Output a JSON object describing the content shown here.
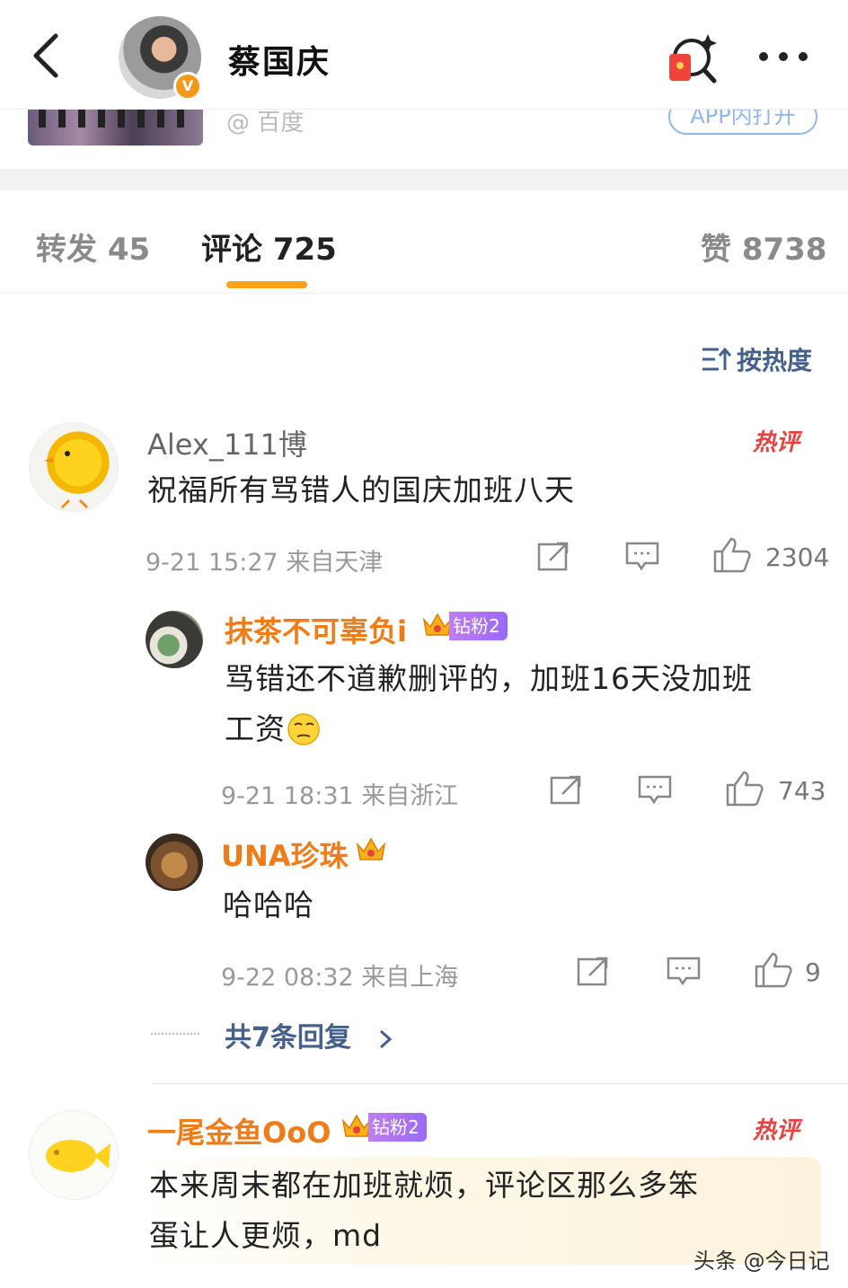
{
  "header": {
    "title": "蔡国庆",
    "verified_badge": "V"
  },
  "card": {
    "source": "@ 百度",
    "open_app_label": "APP内打开"
  },
  "tabs": [
    {
      "label": "转发 45"
    },
    {
      "label": "评论 725"
    },
    {
      "label": "赞 8738"
    }
  ],
  "sort": {
    "label": "按热度"
  },
  "hot_label": "热评",
  "comments": [
    {
      "user": "Alex_111博",
      "text": "祝福所有骂错人的国庆加班八天",
      "meta": "9-21 15:27  来自天津",
      "likes": "2304",
      "replies": [
        {
          "user": "抹茶不可辜负i",
          "badge": "钻粉2",
          "text_line1": "骂错还不道歉删评的，加班16天没加班",
          "text_line2": "工资",
          "meta": "9-21 18:31  来自浙江",
          "likes": "743"
        },
        {
          "user": "UNA珍珠",
          "text": "哈哈哈",
          "meta": "9-22 08:32  来自上海",
          "likes": "9"
        }
      ],
      "more_replies": "共7条回复"
    },
    {
      "user": "一尾金鱼OoO",
      "badge": "钻粉2",
      "text_line1": "本来周末都在加班就烦，评论区那么多笨",
      "text_line2": "蛋让人更烦，md"
    }
  ],
  "watermark": "头条 @今日记",
  "colors": {
    "accent": "#f7a31e",
    "link": "#45608a",
    "hot": "#e8413e",
    "username_orange": "#f07c18"
  }
}
